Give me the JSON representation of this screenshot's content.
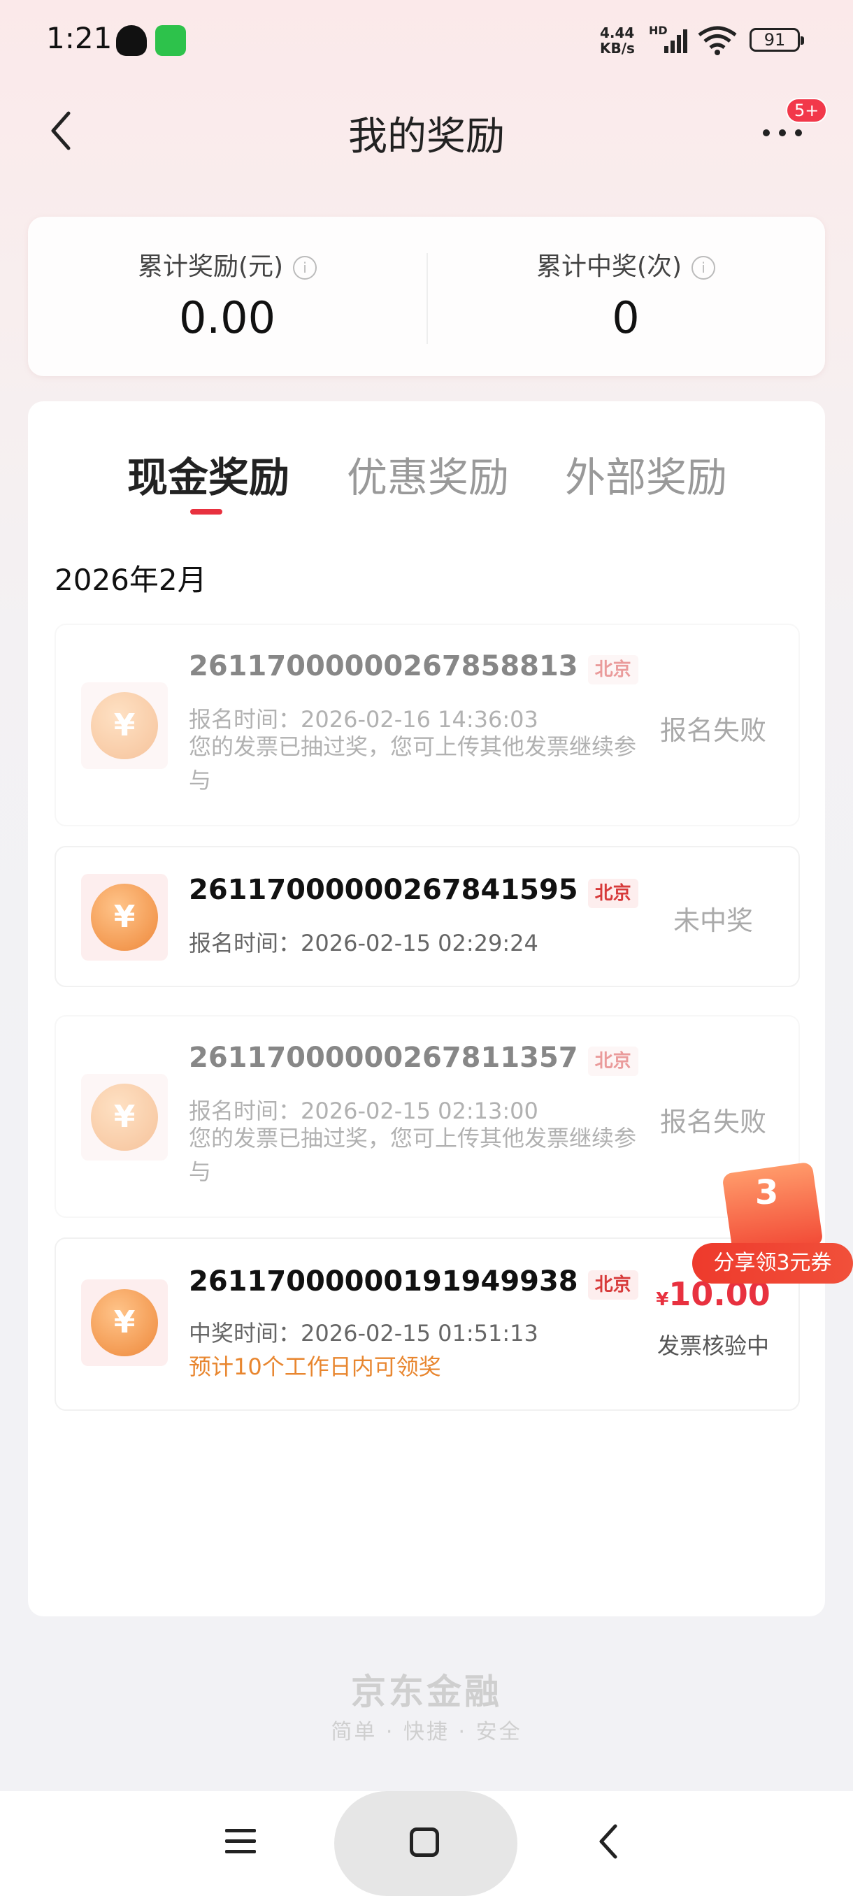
{
  "status_bar": {
    "time": "1:21",
    "net_speed_value": "4.44",
    "net_speed_unit": "KB/s",
    "network_type": "HD",
    "battery": "91",
    "icons": [
      "qq-icon",
      "wechat-icon",
      "signal-icon",
      "wifi-icon",
      "battery-icon"
    ]
  },
  "header": {
    "title": "我的奖励",
    "badge": "5+",
    "icons": [
      "back-icon",
      "more-icon"
    ]
  },
  "summary": {
    "total_reward_label": "累计奖励(元)",
    "total_reward_value": "0.00",
    "total_wins_label": "累计中奖(次)",
    "total_wins_value": "0"
  },
  "tabs": [
    {
      "label": "现金奖励",
      "active": true
    },
    {
      "label": "优惠奖励",
      "active": false
    },
    {
      "label": "外部奖励",
      "active": false
    }
  ],
  "month": "2026年2月",
  "records": [
    {
      "id": "26117000000267858813",
      "region": "北京",
      "time": "报名时间：2026-02-16 14:36:03",
      "note": "您的发票已抽过奖，您可上传其他发票继续参与",
      "status": "报名失败"
    },
    {
      "id": "26117000000267841595",
      "region": "北京",
      "time": "报名时间：2026-02-15 02:29:24",
      "status": "未中奖"
    },
    {
      "id": "26117000000267811357",
      "region": "北京",
      "time": "报名时间：2026-02-15 02:13:00",
      "note": "您的发票已抽过奖，您可上传其他发票继续参与",
      "status": "报名失败"
    },
    {
      "id": "26117000000191949938",
      "region": "北京",
      "time": "中奖时间：2026-02-15 01:51:13",
      "hint": "预计10个工作日内可领奖",
      "currency": "¥",
      "amount": "10.00",
      "status": "发票核验中"
    }
  ],
  "promo": {
    "number": "3",
    "button_label": "分享领3元券"
  },
  "footer": {
    "brand": "京东金融",
    "slogan": "简单 · 快捷 · 安全"
  },
  "colors": {
    "accent": "#e8313f",
    "hint": "#e8862f"
  }
}
